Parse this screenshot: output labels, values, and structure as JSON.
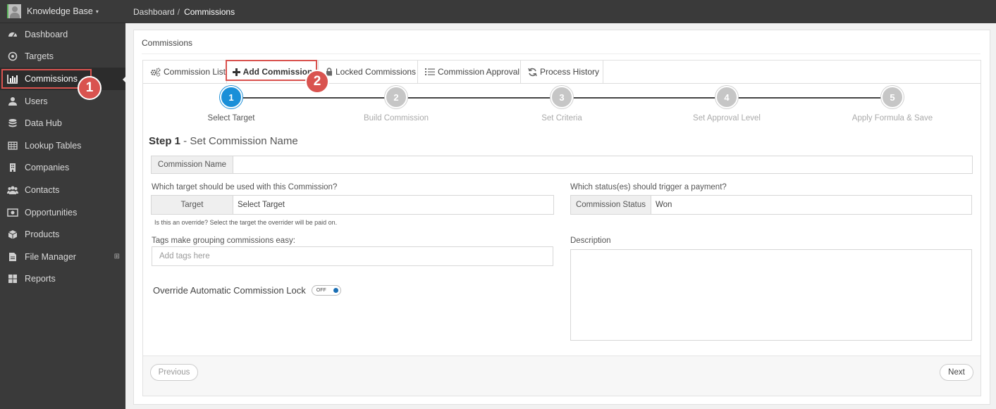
{
  "brand": {
    "name": "Knowledge Base"
  },
  "sidebar": {
    "items": [
      {
        "label": "Dashboard",
        "icon": "dashboard-icon"
      },
      {
        "label": "Targets",
        "icon": "target-icon"
      },
      {
        "label": "Commissions",
        "icon": "bar-chart-icon",
        "active": true
      },
      {
        "label": "Users",
        "icon": "user-icon"
      },
      {
        "label": "Data Hub",
        "icon": "database-icon"
      },
      {
        "label": "Lookup Tables",
        "icon": "table-icon"
      },
      {
        "label": "Companies",
        "icon": "building-icon"
      },
      {
        "label": "Contacts",
        "icon": "users-icon"
      },
      {
        "label": "Opportunities",
        "icon": "money-icon"
      },
      {
        "label": "Products",
        "icon": "box-icon"
      },
      {
        "label": "File Manager",
        "icon": "file-icon"
      },
      {
        "label": "Reports",
        "icon": "grid-icon"
      }
    ]
  },
  "breadcrumb": {
    "root": "Dashboard",
    "separator": "/",
    "current": "Commissions"
  },
  "panel": {
    "title": "Commissions"
  },
  "tabs": [
    {
      "label": "Commission List",
      "icon": "gears-icon"
    },
    {
      "label": "Add Commission",
      "icon": "plus-icon",
      "active": true
    },
    {
      "label": "Locked Commissions",
      "icon": "lock-icon"
    },
    {
      "label": "Commission Approval",
      "icon": "list-icon"
    },
    {
      "label": "Process History",
      "icon": "refresh-icon"
    }
  ],
  "steps": [
    {
      "number": "1",
      "label": "Select Target",
      "active": true
    },
    {
      "number": "2",
      "label": "Build Commission"
    },
    {
      "number": "3",
      "label": "Set Criteria"
    },
    {
      "number": "4",
      "label": "Set Approval Level"
    },
    {
      "number": "5",
      "label": "Apply Formula & Save"
    }
  ],
  "form": {
    "heading_bold": "Step 1",
    "heading_rest": " - Set Commission Name",
    "commission_name": {
      "label": "Commission Name",
      "value": ""
    },
    "target_question": "Which target should be used with this Commission?",
    "target": {
      "label": "Target",
      "value": "Select Target"
    },
    "override_help": "Is this an override?  Select the target the overrider will be paid on.",
    "status_question": "Which status(es) should trigger a payment?",
    "status": {
      "label": "Commission Status",
      "value": "Won"
    },
    "tags_label": "Tags make grouping commissions easy:",
    "tags_placeholder": "Add tags here",
    "description_label": "Description",
    "override_label": "Override Automatic Commission Lock",
    "override_toggle": "OFF"
  },
  "buttons": {
    "previous": "Previous",
    "next": "Next"
  },
  "annotations": {
    "badge1": "1",
    "badge2": "2"
  },
  "colors": {
    "accent": "#1a8fd8",
    "annotation": "#d9534f",
    "sidebar": "#3a3a3a"
  }
}
